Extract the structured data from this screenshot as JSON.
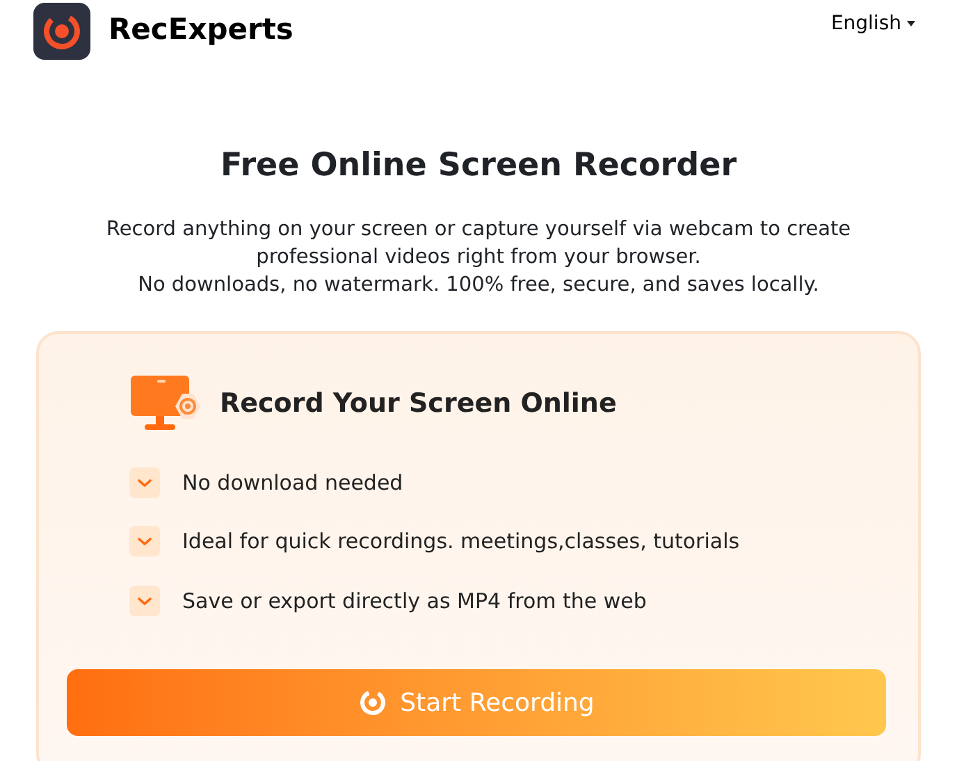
{
  "header": {
    "brand": "RecExperts",
    "language": "English"
  },
  "hero": {
    "title": "Free Online Screen Recorder",
    "description": [
      "Record anything on your screen or capture yourself via webcam to create professional videos right from your browser.",
      "No downloads, no watermark. 100% free, secure, and saves locally."
    ]
  },
  "card": {
    "title": "Record Your Screen Online",
    "features": [
      "No download needed",
      "Ideal for quick recordings. meetings,classes, tutorials",
      "Save or export directly as MP4 from the web"
    ],
    "button": "Start Recording"
  }
}
